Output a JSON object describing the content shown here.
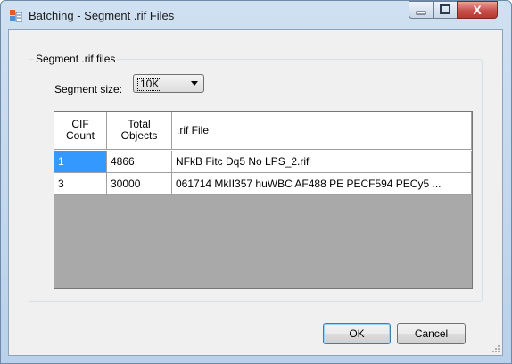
{
  "window": {
    "title": "Batching - Segment .rif Files"
  },
  "titlebar": {
    "close_glyph": "X"
  },
  "group": {
    "label": "Segment .rif files"
  },
  "segment": {
    "label": "Segment size:",
    "selected_value": "10K"
  },
  "table": {
    "columns": [
      {
        "label": "CIF Count"
      },
      {
        "label": "Total Objects"
      },
      {
        "label": ".rif File"
      }
    ],
    "rows": [
      {
        "cif_count": "1",
        "total_objects": "4866",
        "rif_file": "NFkB Fitc Dq5 No LPS_2.rif"
      },
      {
        "cif_count": "3",
        "total_objects": "30000",
        "rif_file": "061714 MkII357 huWBC AF488 PE PECF594 PECy5 ..."
      }
    ]
  },
  "buttons": {
    "ok": "OK",
    "cancel": "Cancel"
  },
  "colors": {
    "selection": "#3399ff",
    "grid_background": "#a9a9a9",
    "dialog_background": "#f0f0f0"
  },
  "icons": {
    "app": "batch-window-icon",
    "minimize": "minimize-icon",
    "maximize": "maximize-icon",
    "close": "close-icon",
    "dropdown": "chevron-down-icon",
    "resize": "resize-grip-icon"
  }
}
